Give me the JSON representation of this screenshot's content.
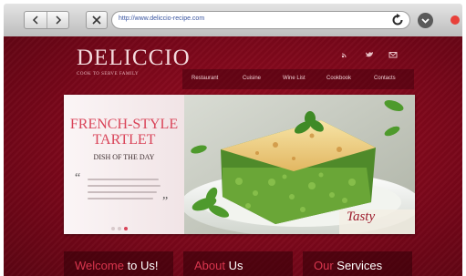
{
  "browser": {
    "url": "http://www.deliccio-recipe.com"
  },
  "site": {
    "logo_name": "DELICCIO",
    "logo_tagline": "COOK TO SERVE FAMILY",
    "nav": [
      {
        "label": "Restaurant"
      },
      {
        "label": "Cuisine"
      },
      {
        "label": "Wine List"
      },
      {
        "label": "Cookbook"
      },
      {
        "label": "Contacts"
      }
    ],
    "hero": {
      "title_line1": "FRENCH-STYLE",
      "title_line2": "TARTLET",
      "subtitle": "DISH OF THE DAY",
      "quote_open": "“",
      "quote_close": "”",
      "signature": "Tasty"
    },
    "boxes": [
      {
        "accent": "Welcome",
        "rest": " to Us!"
      },
      {
        "accent": "About",
        "rest": " Us"
      },
      {
        "accent": "Our",
        "rest": " Services"
      }
    ]
  },
  "colors": {
    "brand_red": "#8a0a1e",
    "accent_pink": "#d94459",
    "record": "#e8403a"
  }
}
